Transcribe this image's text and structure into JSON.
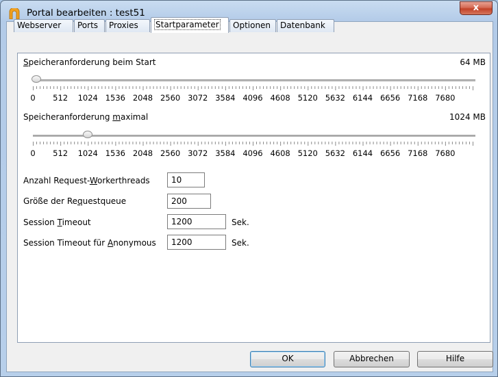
{
  "window": {
    "title": "Portal bearbeiten : test51",
    "close_label": "x"
  },
  "tabs": [
    {
      "label": "Webserver"
    },
    {
      "label": "Ports"
    },
    {
      "label": "Proxies"
    },
    {
      "label": "Startparameter",
      "active": true
    },
    {
      "label": "Optionen"
    },
    {
      "label": "Datenbank"
    }
  ],
  "startparameter": {
    "start_memory": {
      "label_pre": "",
      "label_mnemonic": "S",
      "label_post": "peicheranforderung beim Start",
      "value_text": "64 MB",
      "value": 64,
      "min": 0,
      "max": 8192,
      "scale": [
        "0",
        "512",
        "1024",
        "1536",
        "2048",
        "2560",
        "3072",
        "3584",
        "4096",
        "4608",
        "5120",
        "5632",
        "6144",
        "6656",
        "7168",
        "7680"
      ]
    },
    "max_memory": {
      "label_pre": "Speicheranforderung ",
      "label_mnemonic": "m",
      "label_post": "aximal",
      "value_text": "1024 MB",
      "value": 1024,
      "min": 0,
      "max": 8192,
      "scale": [
        "0",
        "512",
        "1024",
        "1536",
        "2048",
        "2560",
        "3072",
        "3584",
        "4096",
        "4608",
        "5120",
        "5632",
        "6144",
        "6656",
        "7168",
        "7680"
      ]
    },
    "worker_threads": {
      "label_pre": "Anzahl Request-",
      "label_mnemonic": "W",
      "label_post": "orkerthreads",
      "value": "10"
    },
    "request_queue": {
      "label_pre": "Größe der Re",
      "label_mnemonic": "q",
      "label_post": "uestqueue",
      "value": "200"
    },
    "session_timeout": {
      "label_pre": "Session ",
      "label_mnemonic": "T",
      "label_post": "imeout",
      "value": "1200",
      "unit": "Sek."
    },
    "session_timeout_anon": {
      "label_pre": "Session Timeout für ",
      "label_mnemonic": "A",
      "label_post": "nonymous",
      "value": "1200",
      "unit": "Sek."
    }
  },
  "buttons": {
    "ok": "OK",
    "cancel": "Abbrechen",
    "help": "Hilfe"
  }
}
